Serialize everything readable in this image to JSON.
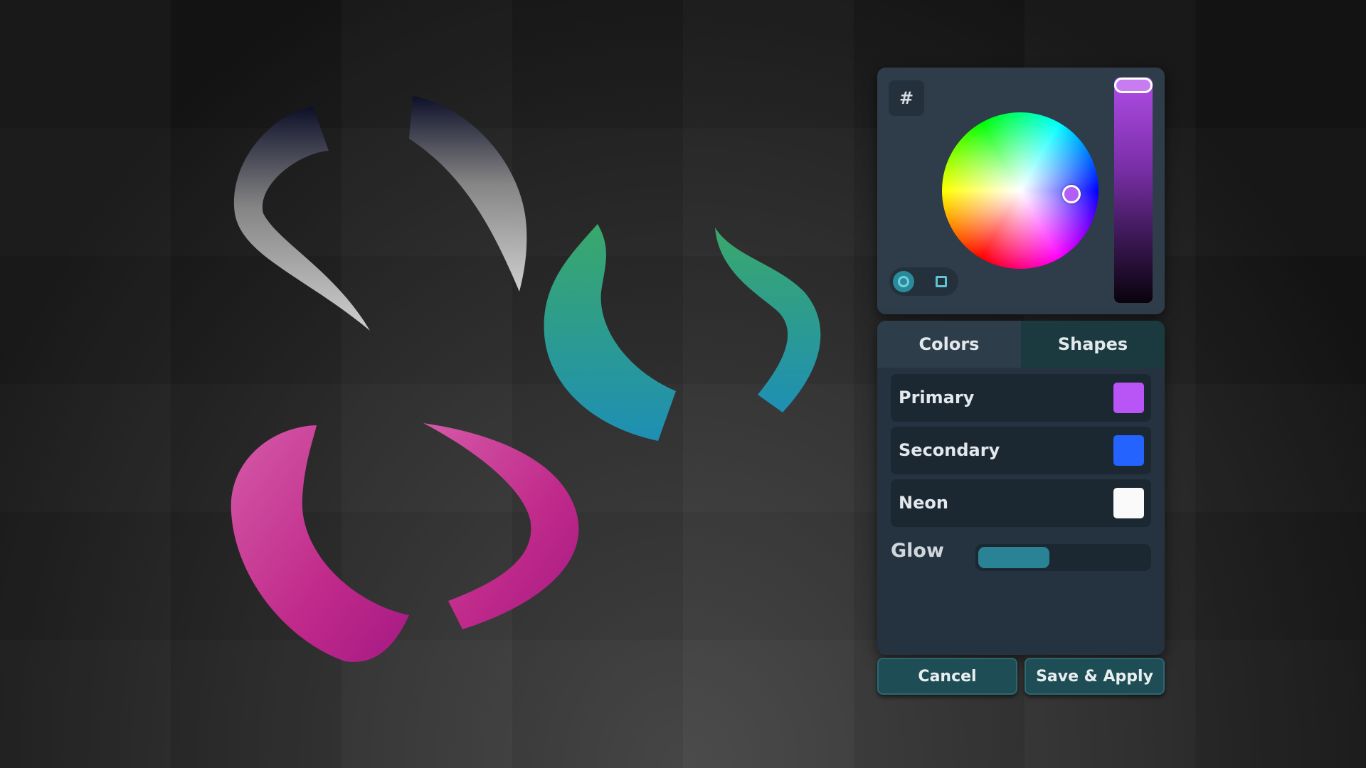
{
  "picker": {
    "hex_label": "#",
    "hue_icon": "color-wheel",
    "brightness_level": 1.0,
    "selected_color": "#b35ef6",
    "shape_modes": [
      "circle",
      "square"
    ],
    "active_shape_mode": "circle"
  },
  "tabs": [
    {
      "label": "Colors"
    },
    {
      "label": "Shapes"
    }
  ],
  "color_rows": [
    {
      "label": "Primary",
      "color": "#b955f7"
    },
    {
      "label": "Secondary",
      "color": "#2563ff"
    },
    {
      "label": "Neon",
      "color": "#fafafa"
    }
  ],
  "glow": {
    "label": "Glow",
    "level": 0.42
  },
  "actions": {
    "cancel_label": "Cancel",
    "save_label": "Save & Apply"
  },
  "horns": [
    "starry-white-pair",
    "teal-galaxy-pair",
    "pink-nebula-pair"
  ]
}
